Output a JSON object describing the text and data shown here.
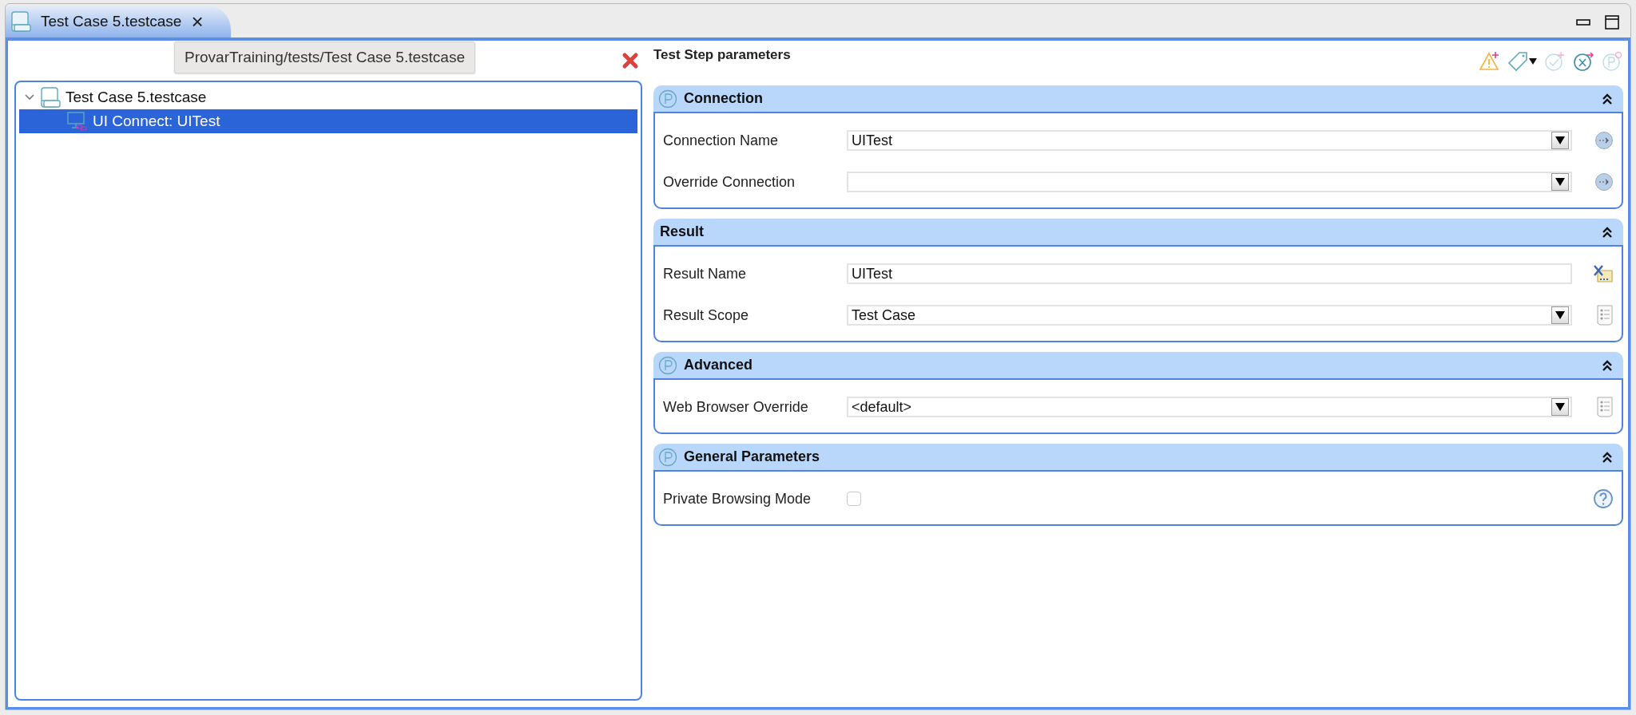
{
  "editor_tab": {
    "title": "Test Case 5.testcase",
    "close": "×",
    "selected": true
  },
  "tooltip": "ProvarTraining/tests/Test Case 5.testcase",
  "tree": [
    {
      "label": "Test Case 5.testcase",
      "kind": "testcase",
      "expanded": true,
      "selected": false,
      "children": [
        {
          "label": "UI Connect: UITest",
          "kind": "connect",
          "selected": true
        }
      ]
    }
  ],
  "panel_title": "Test Step parameters",
  "toolbar": [
    {
      "kind": "add-warning",
      "disabled": false
    },
    {
      "kind": "tag",
      "disabled": false
    },
    {
      "kind": "add-check",
      "disabled": true
    },
    {
      "kind": "variable",
      "disabled": false
    },
    {
      "kind": "parameter-settings",
      "disabled": true
    }
  ],
  "sections": [
    {
      "title": "Connection",
      "kind": "parameter",
      "expanded": true,
      "fields": [
        {
          "label": "Connection Name",
          "kind": "combo",
          "value": "UITest",
          "side_button": {
            "kind": "link"
          }
        },
        {
          "label": "Override Connection",
          "kind": "combo",
          "side_button": {
            "kind": "link"
          }
        }
      ]
    },
    {
      "title": "Result",
      "kind": "plain",
      "expanded": true,
      "fields": [
        {
          "label": "Result Name",
          "kind": "text",
          "value": "UITest",
          "side_button": {
            "kind": "variable"
          }
        },
        {
          "label": "Result Scope",
          "kind": "combo",
          "value": "Test Case",
          "side_button": {
            "kind": "list"
          }
        }
      ]
    },
    {
      "title": "Advanced",
      "kind": "parameter",
      "expanded": true,
      "fields": [
        {
          "label": "Web Browser Override",
          "kind": "combo",
          "value": "<default>",
          "side_button": {
            "kind": "list"
          }
        }
      ]
    },
    {
      "title": "General Parameters",
      "kind": "parameter",
      "expanded": true,
      "fields": [
        {
          "label": "Private Browsing Mode",
          "kind": "checkbox",
          "checked": false,
          "side_button": {
            "kind": "help"
          }
        }
      ]
    }
  ]
}
